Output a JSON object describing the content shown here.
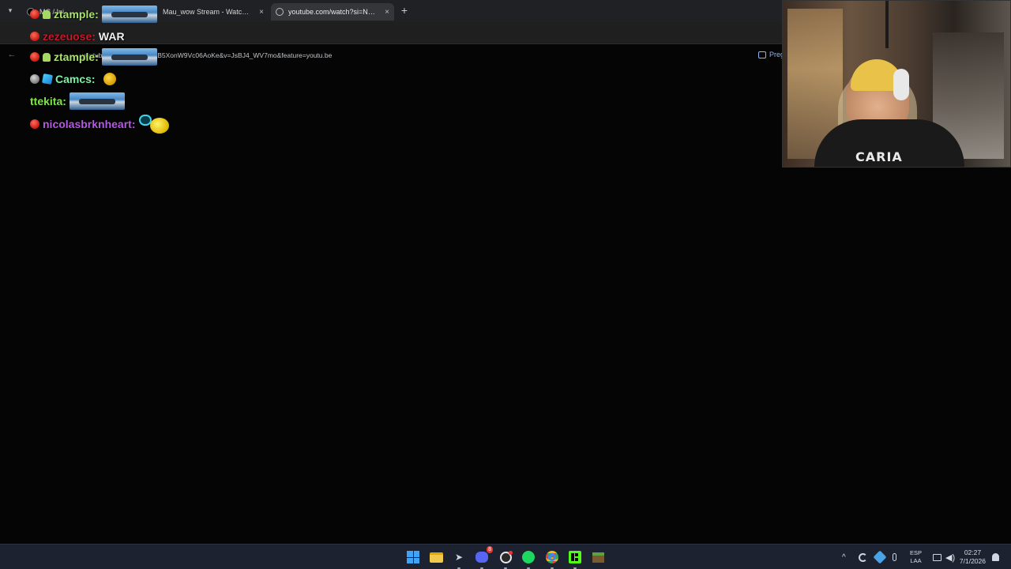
{
  "browser": {
    "tabs": [
      {
        "title": "MC / Inicio / X",
        "active": false
      },
      {
        "title": "Mau_wow Stream - Watch Live",
        "active": false
      },
      {
        "title": "youtube.com/watch?si=N85Xo",
        "active": true
      }
    ],
    "close_glyph": "×",
    "new_tab_glyph": "+",
    "url": "youtube.com/watch?si=NB5XonW9Vc06AoKe&v=JsBJ4_WV7mo&feature=youtu.be",
    "pip_label": "Preg"
  },
  "chat": {
    "messages": [
      {
        "user": "zezeuose",
        "user_color": "#c8182b",
        "text": "WAR",
        "badge": "red"
      },
      {
        "user": "ztample",
        "user_color": "#a9e36b",
        "text": "",
        "badge": "red",
        "badge2": "android",
        "emote": "plane"
      },
      {
        "user": "ztample",
        "user_color": "#a9e36b",
        "text": "",
        "badge": "red",
        "badge2": "android",
        "emote": "plane"
      },
      {
        "user": "Camcs",
        "user_color": "#7ef1a6",
        "text": "",
        "badge": "grey",
        "badge2": "cube",
        "emote": "small"
      },
      {
        "user": "ttekita",
        "user_color": "#7ee84a",
        "text": "",
        "emote": "plane"
      },
      {
        "user": "nicolasbrknheart",
        "user_color": "#b55ae0",
        "text": "",
        "badge": "red",
        "emote": "bubble"
      }
    ]
  },
  "webcam": {
    "shirt_text": "CARIA"
  },
  "taskbar": {
    "icons": [
      "windows-start-icon",
      "file-explorer-icon",
      "steam-icon",
      "discord-icon",
      "obs-icon",
      "spotify-icon",
      "chrome-icon",
      "kick-icon",
      "minecraft-icon"
    ],
    "discord_badge": "8",
    "lang_top": "ESP",
    "lang_bottom": "LAA",
    "time": "02:27",
    "date": "7/1/2026"
  }
}
